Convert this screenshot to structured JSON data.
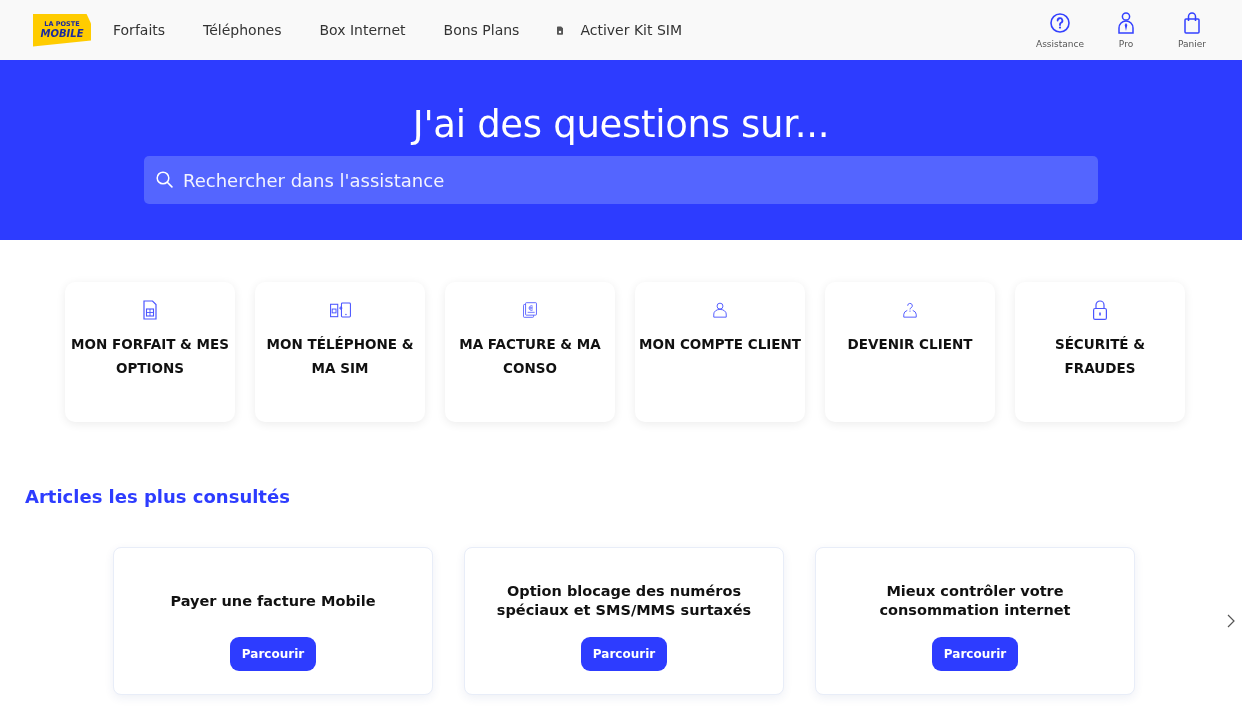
{
  "header": {
    "logo": {
      "line_1": "LA POSTE",
      "line_2": "MOBILE"
    },
    "nav": [
      {
        "label": "Forfaits",
        "kind": "link"
      },
      {
        "label": "Téléphones",
        "kind": "link"
      },
      {
        "label": "Box Internet",
        "kind": "link"
      },
      {
        "label": "Bons Plans",
        "kind": "link"
      },
      {
        "label": "Activer Kit SIM",
        "kind": "sim"
      }
    ],
    "actions": [
      {
        "label": "Assistance",
        "kind": "help"
      },
      {
        "label": "Pro",
        "kind": "pro"
      },
      {
        "label": "Panier",
        "kind": "cart"
      }
    ]
  },
  "hero": {
    "title": "J'ai des questions sur...",
    "search": {
      "placeholder": "Rechercher dans l'assistance"
    }
  },
  "categories": [
    {
      "label": "MON FORFAIT & MES OPTIONS",
      "kind": "sim"
    },
    {
      "label": "MON TÉLÉPHONE & MA SIM",
      "kind": "phone"
    },
    {
      "label": "MA FACTURE & MA CONSO",
      "kind": "bill"
    },
    {
      "label": "MON COMPTE CLIENT",
      "kind": "account"
    },
    {
      "label": "DEVENIR CLIENT",
      "kind": "newclient"
    },
    {
      "label": "SÉCURITÉ & FRAUDES",
      "kind": "lock"
    }
  ],
  "articles": {
    "title": "Articles les plus consultés",
    "items": [
      {
        "title": "Payer une facture Mobile",
        "button": "Parcourir"
      },
      {
        "title": "Option blocage des numéros spéciaux et SMS/MMS surtaxés",
        "button": "Parcourir"
      },
      {
        "title": "Mieux contrôler votre consommation internet",
        "button": "Parcourir"
      }
    ]
  }
}
